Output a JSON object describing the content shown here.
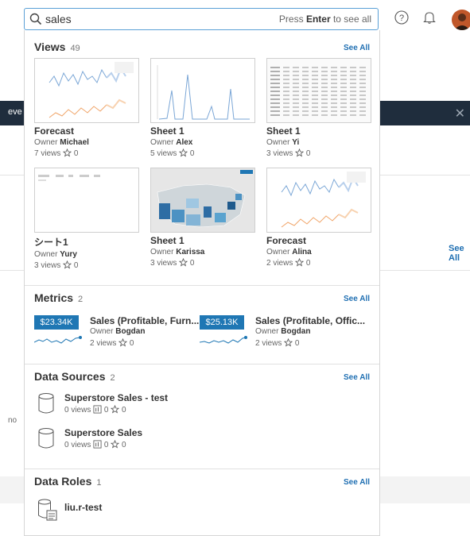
{
  "search": {
    "value": "sales",
    "hint_pre": "Press ",
    "hint_key": "Enter",
    "hint_post": " to see all"
  },
  "background": {
    "banner_text": "eve",
    "see_all": "See All",
    "side_text": "no"
  },
  "views": {
    "title": "Views",
    "count": "49",
    "see_all": "See All",
    "items": [
      {
        "name": "Forecast",
        "owner_label": "Owner",
        "owner": "Michael",
        "views": "7 views",
        "favs": "0",
        "thumb": "line-forecast"
      },
      {
        "name": "Sheet 1",
        "owner_label": "Owner",
        "owner": "Alex",
        "views": "5 views",
        "favs": "0",
        "thumb": "spikes"
      },
      {
        "name": "Sheet 1",
        "owner_label": "Owner",
        "owner": "Yi",
        "views": "3 views",
        "favs": "0",
        "thumb": "table"
      },
      {
        "name": "シート1",
        "owner_label": "Owner",
        "owner": "Yury",
        "views": "3 views",
        "favs": "0",
        "thumb": "sparse-table"
      },
      {
        "name": "Sheet 1",
        "owner_label": "Owner",
        "owner": "Karissa",
        "views": "3 views",
        "favs": "0",
        "thumb": "map"
      },
      {
        "name": "Forecast",
        "owner_label": "Owner",
        "owner": "Alina",
        "views": "2 views",
        "favs": "0",
        "thumb": "line-forecast"
      }
    ]
  },
  "metrics": {
    "title": "Metrics",
    "count": "2",
    "see_all": "See All",
    "items": [
      {
        "value": "$23.34K",
        "name": "Sales (Profitable, Furn...",
        "owner_label": "Owner",
        "owner": "Bogdan",
        "views": "2 views",
        "favs": "0"
      },
      {
        "value": "$25.13K",
        "name": "Sales (Profitable, Offic...",
        "owner_label": "Owner",
        "owner": "Bogdan",
        "views": "2 views",
        "favs": "0"
      }
    ]
  },
  "data_sources": {
    "title": "Data Sources",
    "count": "2",
    "see_all": "See All",
    "items": [
      {
        "name": "Superstore Sales - test",
        "views": "0 views",
        "connections": "0",
        "favs": "0"
      },
      {
        "name": "Superstore Sales",
        "views": "0 views",
        "connections": "0",
        "favs": "0"
      }
    ]
  },
  "data_roles": {
    "title": "Data Roles",
    "count": "1",
    "see_all": "See All",
    "items": [
      {
        "name": "liu.r-test"
      }
    ]
  },
  "icons": {
    "search": "search-icon",
    "help": "help-icon",
    "bell": "bell-icon",
    "star": "star-icon",
    "database": "database-icon",
    "data-role": "data-role-icon"
  },
  "colors": {
    "accent": "#1f6fb2",
    "metric_badge": "#1f77b4",
    "banner": "#1f2d3d"
  }
}
